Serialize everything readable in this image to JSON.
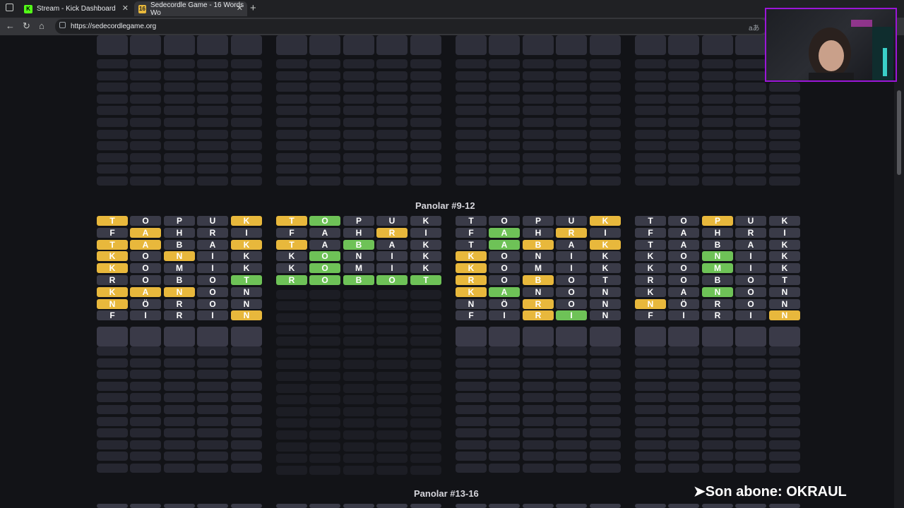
{
  "browser": {
    "tabs": [
      {
        "title": "Stream - Kick Dashboard",
        "favicon": "K"
      },
      {
        "title": "Sedecordle Game - 16 Words Wo",
        "favicon": "16"
      }
    ],
    "url": "https://sedecordlegame.org",
    "translate_icon": "aあ"
  },
  "colors": {
    "yellow": "#e8b83c",
    "green": "#6ec257",
    "gray": "#3a3b48",
    "empty": "#262731",
    "bg": "#121317",
    "accent": "#9b16d8"
  },
  "sections": {
    "middle_title": "Panolar #9-12",
    "bottom_title": "Panolar #13-16"
  },
  "boards": [
    {
      "rows": [
        [
          [
            "T",
            "y"
          ],
          [
            "O",
            "g"
          ],
          [
            "P",
            "g"
          ],
          [
            "U",
            "g"
          ],
          [
            "K",
            "y"
          ]
        ],
        [
          [
            "F",
            "g"
          ],
          [
            "A",
            "y"
          ],
          [
            "H",
            "g"
          ],
          [
            "R",
            "g"
          ],
          [
            "I",
            "g"
          ]
        ],
        [
          [
            "T",
            "y"
          ],
          [
            "A",
            "y"
          ],
          [
            "B",
            "g"
          ],
          [
            "A",
            "g"
          ],
          [
            "K",
            "y"
          ]
        ],
        [
          [
            "K",
            "y"
          ],
          [
            "O",
            "g"
          ],
          [
            "N",
            "y"
          ],
          [
            "I",
            "g"
          ],
          [
            "K",
            "g"
          ]
        ],
        [
          [
            "K",
            "y"
          ],
          [
            "O",
            "g"
          ],
          [
            "M",
            "g"
          ],
          [
            "I",
            "g"
          ],
          [
            "K",
            "g"
          ]
        ],
        [
          [
            "R",
            "g"
          ],
          [
            "O",
            "g"
          ],
          [
            "B",
            "g"
          ],
          [
            "O",
            "g"
          ],
          [
            "T",
            "G"
          ]
        ],
        [
          [
            "K",
            "y"
          ],
          [
            "A",
            "y"
          ],
          [
            "N",
            "y"
          ],
          [
            "O",
            "g"
          ],
          [
            "N",
            "g"
          ]
        ],
        [
          [
            "N",
            "y"
          ],
          [
            "Ö",
            "g"
          ],
          [
            "R",
            "g"
          ],
          [
            "O",
            "g"
          ],
          [
            "N",
            "g"
          ]
        ],
        [
          [
            "F",
            "g"
          ],
          [
            "I",
            "g"
          ],
          [
            "R",
            "g"
          ],
          [
            "I",
            "g"
          ],
          [
            "N",
            "y"
          ]
        ]
      ]
    },
    {
      "rows": [
        [
          [
            "T",
            "y"
          ],
          [
            "O",
            "G"
          ],
          [
            "P",
            "g"
          ],
          [
            "U",
            "g"
          ],
          [
            "K",
            "g"
          ]
        ],
        [
          [
            "F",
            "g"
          ],
          [
            "A",
            "g"
          ],
          [
            "H",
            "g"
          ],
          [
            "R",
            "y"
          ],
          [
            "I",
            "g"
          ]
        ],
        [
          [
            "T",
            "y"
          ],
          [
            "A",
            "g"
          ],
          [
            "B",
            "G"
          ],
          [
            "A",
            "g"
          ],
          [
            "K",
            "g"
          ]
        ],
        [
          [
            "K",
            "g"
          ],
          [
            "O",
            "G"
          ],
          [
            "N",
            "g"
          ],
          [
            "I",
            "g"
          ],
          [
            "K",
            "g"
          ]
        ],
        [
          [
            "K",
            "g"
          ],
          [
            "O",
            "G"
          ],
          [
            "M",
            "g"
          ],
          [
            "I",
            "g"
          ],
          [
            "K",
            "g"
          ]
        ],
        [
          [
            "R",
            "G"
          ],
          [
            "O",
            "G"
          ],
          [
            "B",
            "G"
          ],
          [
            "O",
            "G"
          ],
          [
            "T",
            "G"
          ]
        ]
      ]
    },
    {
      "rows": [
        [
          [
            "T",
            "g"
          ],
          [
            "O",
            "g"
          ],
          [
            "P",
            "g"
          ],
          [
            "U",
            "g"
          ],
          [
            "K",
            "y"
          ]
        ],
        [
          [
            "F",
            "g"
          ],
          [
            "A",
            "G"
          ],
          [
            "H",
            "g"
          ],
          [
            "R",
            "y"
          ],
          [
            "I",
            "g"
          ]
        ],
        [
          [
            "T",
            "g"
          ],
          [
            "A",
            "G"
          ],
          [
            "B",
            "y"
          ],
          [
            "A",
            "g"
          ],
          [
            "K",
            "y"
          ]
        ],
        [
          [
            "K",
            "y"
          ],
          [
            "O",
            "g"
          ],
          [
            "N",
            "g"
          ],
          [
            "I",
            "g"
          ],
          [
            "K",
            "g"
          ]
        ],
        [
          [
            "K",
            "y"
          ],
          [
            "O",
            "g"
          ],
          [
            "M",
            "g"
          ],
          [
            "I",
            "g"
          ],
          [
            "K",
            "g"
          ]
        ],
        [
          [
            "R",
            "y"
          ],
          [
            "O",
            "g"
          ],
          [
            "B",
            "y"
          ],
          [
            "O",
            "g"
          ],
          [
            "T",
            "g"
          ]
        ],
        [
          [
            "K",
            "y"
          ],
          [
            "A",
            "G"
          ],
          [
            "N",
            "g"
          ],
          [
            "O",
            "g"
          ],
          [
            "N",
            "g"
          ]
        ],
        [
          [
            "N",
            "g"
          ],
          [
            "Ö",
            "g"
          ],
          [
            "R",
            "y"
          ],
          [
            "O",
            "g"
          ],
          [
            "N",
            "g"
          ]
        ],
        [
          [
            "F",
            "g"
          ],
          [
            "I",
            "g"
          ],
          [
            "R",
            "y"
          ],
          [
            "I",
            "G"
          ],
          [
            "N",
            "g"
          ]
        ]
      ]
    },
    {
      "rows": [
        [
          [
            "T",
            "g"
          ],
          [
            "O",
            "g"
          ],
          [
            "P",
            "y"
          ],
          [
            "U",
            "g"
          ],
          [
            "K",
            "g"
          ]
        ],
        [
          [
            "F",
            "g"
          ],
          [
            "A",
            "g"
          ],
          [
            "H",
            "g"
          ],
          [
            "R",
            "g"
          ],
          [
            "I",
            "g"
          ]
        ],
        [
          [
            "T",
            "g"
          ],
          [
            "A",
            "g"
          ],
          [
            "B",
            "g"
          ],
          [
            "A",
            "g"
          ],
          [
            "K",
            "g"
          ]
        ],
        [
          [
            "K",
            "g"
          ],
          [
            "O",
            "g"
          ],
          [
            "N",
            "G"
          ],
          [
            "I",
            "g"
          ],
          [
            "K",
            "g"
          ]
        ],
        [
          [
            "K",
            "g"
          ],
          [
            "O",
            "g"
          ],
          [
            "M",
            "G"
          ],
          [
            "I",
            "g"
          ],
          [
            "K",
            "g"
          ]
        ],
        [
          [
            "R",
            "g"
          ],
          [
            "O",
            "g"
          ],
          [
            "B",
            "g"
          ],
          [
            "O",
            "g"
          ],
          [
            "T",
            "g"
          ]
        ],
        [
          [
            "K",
            "g"
          ],
          [
            "A",
            "g"
          ],
          [
            "N",
            "G"
          ],
          [
            "O",
            "g"
          ],
          [
            "N",
            "g"
          ]
        ],
        [
          [
            "N",
            "y"
          ],
          [
            "Ö",
            "g"
          ],
          [
            "R",
            "g"
          ],
          [
            "O",
            "g"
          ],
          [
            "N",
            "g"
          ]
        ],
        [
          [
            "F",
            "g"
          ],
          [
            "I",
            "g"
          ],
          [
            "R",
            "g"
          ],
          [
            "I",
            "g"
          ],
          [
            "N",
            "y"
          ]
        ]
      ]
    }
  ],
  "overlay": {
    "text": "➤Son abone: OKRAUL"
  }
}
